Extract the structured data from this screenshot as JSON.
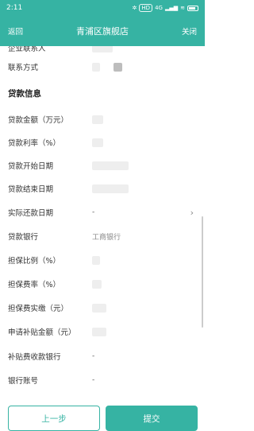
{
  "status_bar": {
    "time": "2:11",
    "hd_badge": "HD",
    "network": "4G"
  },
  "nav": {
    "back": "返回",
    "title": "青浦区旗舰店",
    "close": "关闭"
  },
  "form": {
    "partial_top_label": "企业联系人",
    "contact_label": "联系方式",
    "loan_section_title": "贷款信息",
    "fields": [
      {
        "label": "贷款金额（万元）",
        "value": ""
      },
      {
        "label": "贷款利率（%）",
        "value": ""
      },
      {
        "label": "贷款开始日期",
        "value": ""
      },
      {
        "label": "贷款结束日期",
        "value": ""
      },
      {
        "label": "实际还款日期",
        "value": "-"
      },
      {
        "label": "贷款银行",
        "value": "工商银行"
      },
      {
        "label": "担保比例（%）",
        "value": ""
      },
      {
        "label": "担保费率（%）",
        "value": ""
      },
      {
        "label": "担保费实缴（元）",
        "value": ""
      },
      {
        "label": "申请补贴金额（元）",
        "value": ""
      },
      {
        "label": "补贴费收款银行",
        "value": "-"
      },
      {
        "label": "银行账号",
        "value": "-"
      }
    ]
  },
  "footer": {
    "prev_label": "上一步",
    "submit_label": "提交"
  },
  "colors": {
    "accent": "#36b3a3"
  }
}
